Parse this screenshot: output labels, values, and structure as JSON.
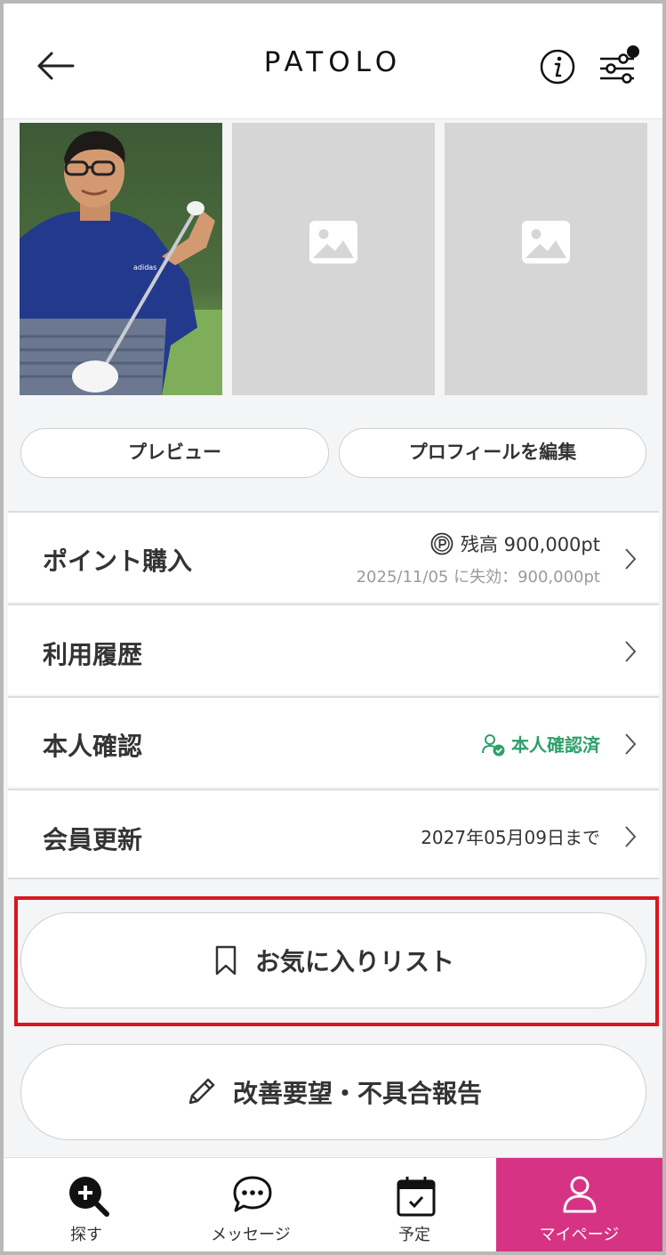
{
  "header": {
    "logo": "PATOLO",
    "back_icon": "arrow-left-icon",
    "info_icon": "info-icon",
    "filter_icon": "sliders-icon"
  },
  "photos": [
    {
      "name": "profile-photo-1",
      "empty": false
    },
    {
      "name": "profile-photo-2",
      "empty": true
    },
    {
      "name": "profile-photo-3",
      "empty": true
    }
  ],
  "actions": {
    "preview_label": "プレビュー",
    "edit_profile_label": "プロフィールを編集"
  },
  "menu": {
    "points": {
      "label": "ポイント購入",
      "balance": "残高 900,000pt",
      "expiry": "2025/11/05 に失効：900,000pt"
    },
    "history": {
      "label": "利用履歴"
    },
    "identity": {
      "label": "本人確認",
      "status": "本人確認済",
      "status_color": "#2ea06a"
    },
    "membership": {
      "label": "会員更新",
      "until": "2027年05月09日まで"
    }
  },
  "buttons": {
    "favorites_label": "お気に入りリスト",
    "report_label": "改善要望・不具合報告"
  },
  "tabbar": {
    "tabs": [
      {
        "label": "探す",
        "icon": "search-plus-icon",
        "active": false
      },
      {
        "label": "メッセージ",
        "icon": "chat-bubble-icon",
        "active": false
      },
      {
        "label": "予定",
        "icon": "calendar-check-icon",
        "active": false
      },
      {
        "label": "マイページ",
        "icon": "user-icon",
        "active": true
      }
    ],
    "active_color": "#d63384"
  },
  "highlight_color": "#d9171f"
}
